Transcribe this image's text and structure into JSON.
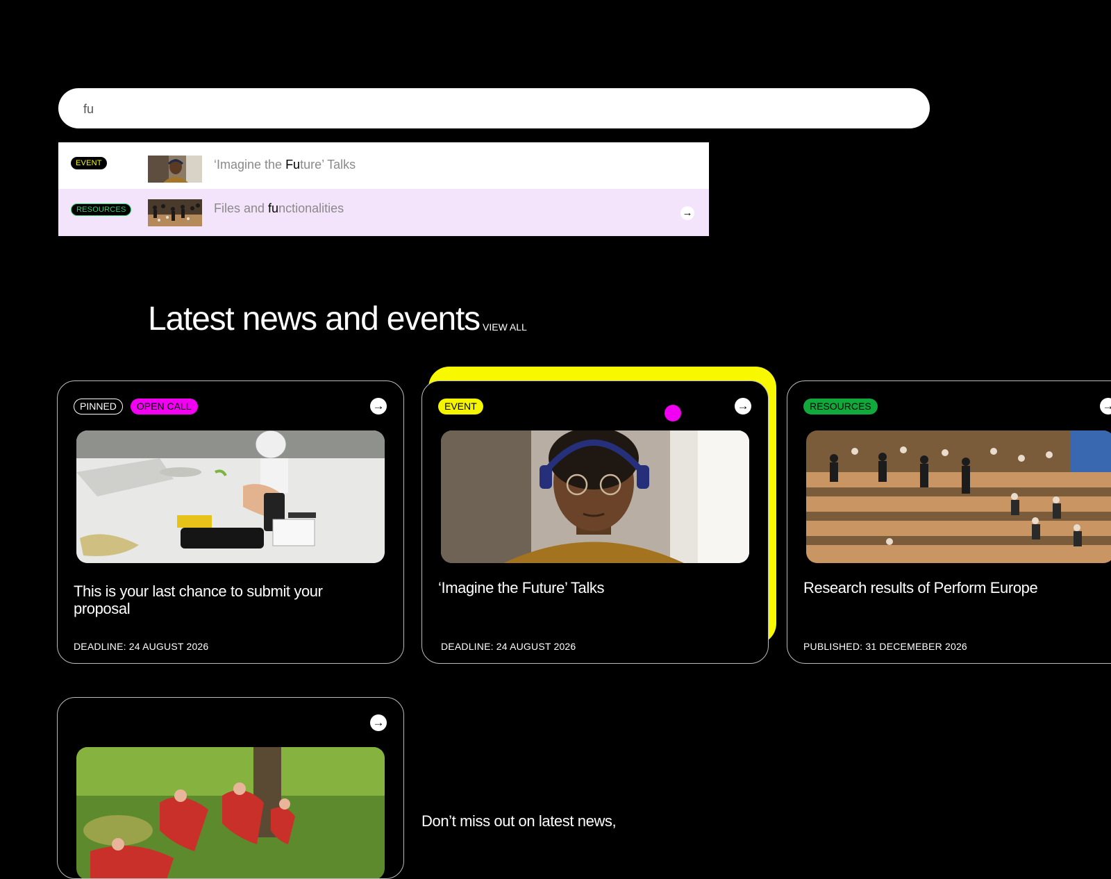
{
  "search": {
    "value": "fu",
    "placeholder": ""
  },
  "suggestions": [
    {
      "tag": "EVENT",
      "title_pre": "‘Imagine the ",
      "title_match": "Fu",
      "title_post": "ture’ Talks"
    },
    {
      "tag": "RESOURCES",
      "title_pre": "Files and ",
      "title_match": "fu",
      "title_post": "nctionalities",
      "arrow": "→"
    }
  ],
  "section": {
    "heading": "Latest news and events",
    "view_all": "VIEW ALL"
  },
  "cards": [
    {
      "badges": [
        "PINNED",
        "OPEN CALL"
      ],
      "title": "This is your last chance to submit your proposal",
      "meta": "DEADLINE: 24 AUGUST 2026",
      "arrow": "→"
    },
    {
      "badges": [
        "EVENT"
      ],
      "title": "‘Imagine the Future’ Talks",
      "meta": "DEADLINE: 24 AUGUST 2026",
      "arrow": "→"
    },
    {
      "badges": [
        "RESOURCES"
      ],
      "title": "Research results of Perform Europe",
      "meta": "PUBLISHED:  31 DECEMEBER 2026",
      "arrow": "→"
    },
    {
      "badges": [],
      "title": "",
      "meta": "",
      "arrow": "→"
    }
  ],
  "newsletter": {
    "text": "Don’t miss out on latest news,"
  },
  "colors": {
    "accent_yellow": "#f5f500",
    "accent_magenta": "#f200f2",
    "accent_green": "#11a83c",
    "highlight_row": "#f3e3fb"
  },
  "icons": {
    "arrow": "arrow-right-icon"
  }
}
